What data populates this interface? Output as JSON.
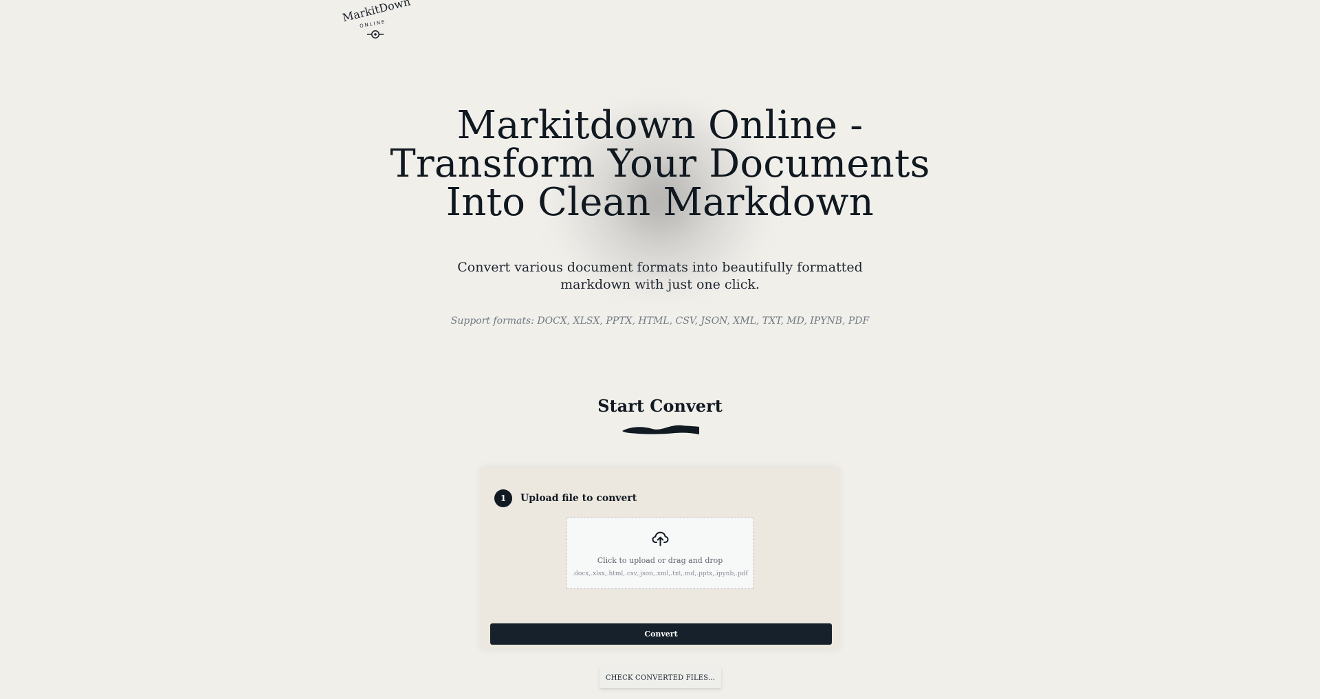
{
  "brand": {
    "logo_text": "MarkitDown",
    "logo_subtext": "ONLINE",
    "logo_mark_icon": "circle-target-icon"
  },
  "hero": {
    "title": "Markitdown Online - Transform Your Documents Into Clean Markdown",
    "subtitle": "Convert various document formats into beautifully formatted markdown with just one click.",
    "supported_formats": "Support formats: DOCX, XLSX, PPTX, HTML, CSV, JSON, XML, TXT, MD, IPYNB, PDF"
  },
  "converter": {
    "section_title": "Start Convert",
    "underline_icon": "brush-underline-icon",
    "step": {
      "number": "1",
      "label": "Upload file to convert"
    },
    "dropzone": {
      "icon": "cloud-upload-icon",
      "main_text": "Click to upload or drag and drop",
      "accepted_formats": ".docx,.xlsx,.html,.csv,.json,.xml,.txt,.md,.pptx,.ipynb,.pdf"
    },
    "convert_label": "Convert"
  },
  "footer_actions": {
    "check_files_label": "CHECK CONVERTED FILES..."
  },
  "colors": {
    "background": "#f1efea",
    "card_background": "#ece7df",
    "primary": "#16212b",
    "muted_text": "#707983"
  }
}
